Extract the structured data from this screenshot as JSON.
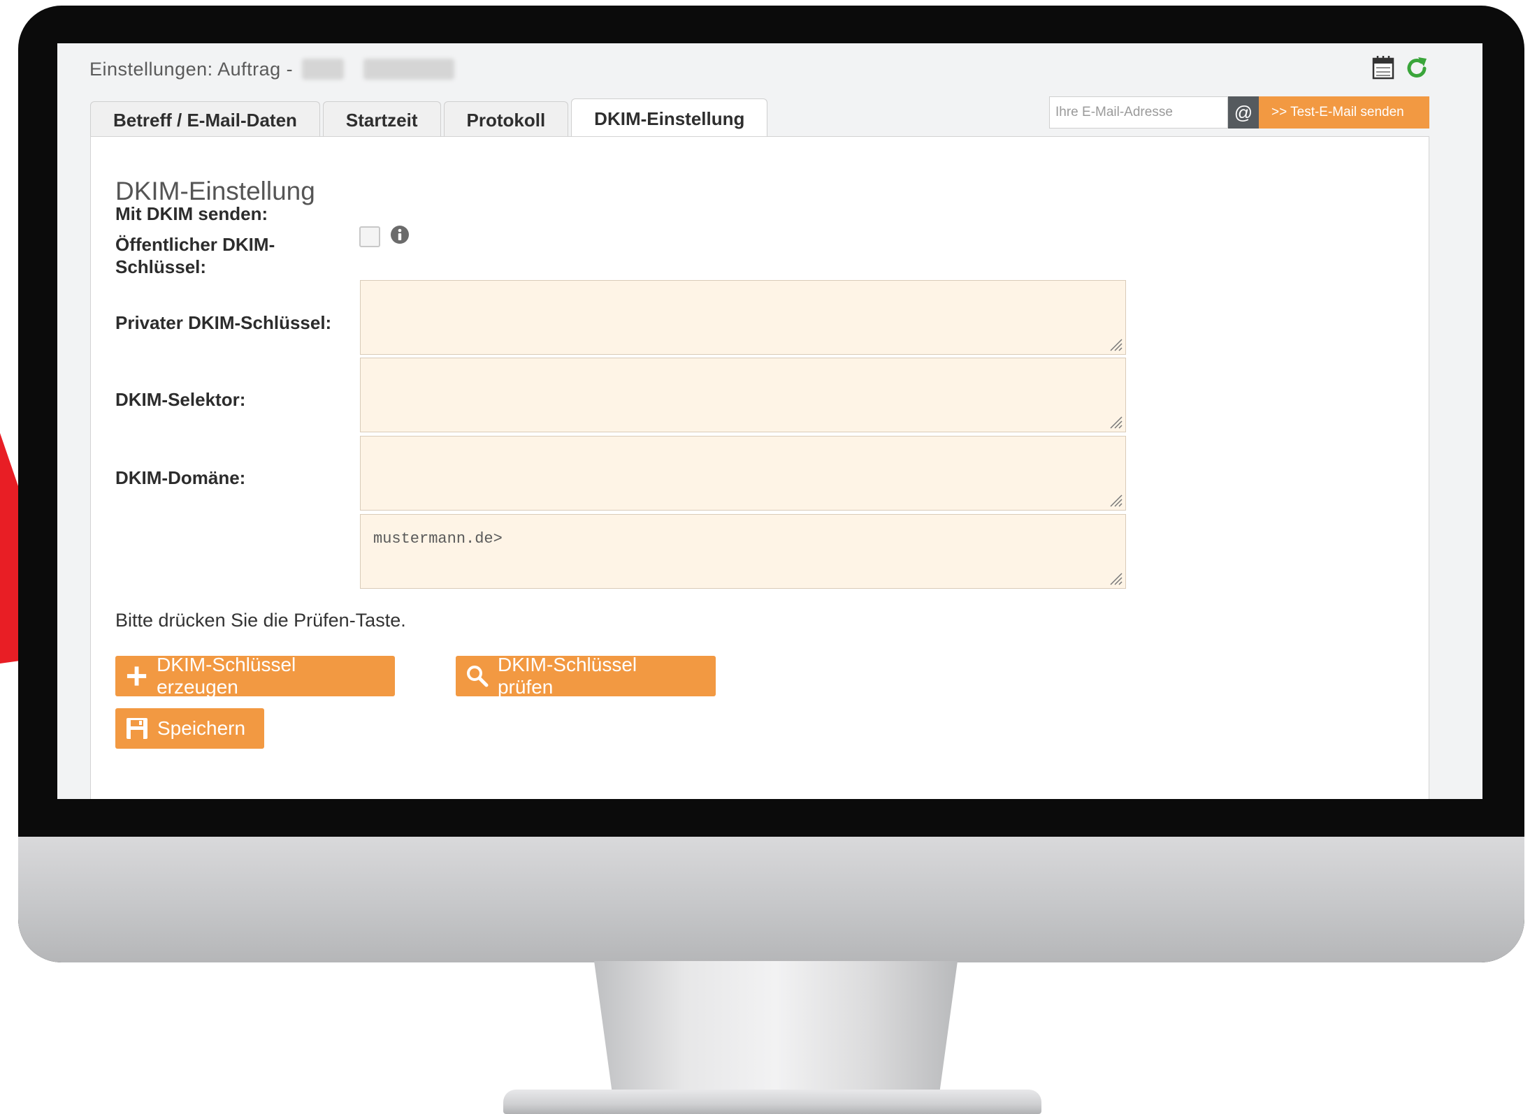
{
  "header": {
    "title": "Einstellungen: Auftrag -"
  },
  "tabs": [
    {
      "label": "Betreff / E-Mail-Daten"
    },
    {
      "label": "Startzeit"
    },
    {
      "label": "Protokoll"
    },
    {
      "label": "DKIM-Einstellung"
    }
  ],
  "test_mail": {
    "placeholder": "Ihre E-Mail-Adresse",
    "at_symbol": "@",
    "send_label": ">> Test-E-Mail senden"
  },
  "section": {
    "title": "DKIM-Einstellung"
  },
  "form": {
    "send_with_dkim_label": "Mit DKIM senden:",
    "public_key_label_line1": "Öffentlicher DKIM-",
    "public_key_label_line2": "Schlüssel:",
    "private_key_label": "Privater DKIM-Schlüssel:",
    "selector_label": "DKIM-Selektor:",
    "domain_label": "DKIM-Domäne:",
    "domain_value": "mustermann.de>"
  },
  "hint": "Bitte drücken Sie die Prüfen-Taste.",
  "buttons": {
    "generate_label": "DKIM-Schlüssel erzeugen",
    "check_label": "DKIM-Schlüssel prüfen",
    "save_label": "Speichern"
  },
  "colors": {
    "accent": "#f29942",
    "field_bg": "#fef4e6",
    "refresh_green": "#3aa53a",
    "arrow_red": "#e81e25"
  }
}
